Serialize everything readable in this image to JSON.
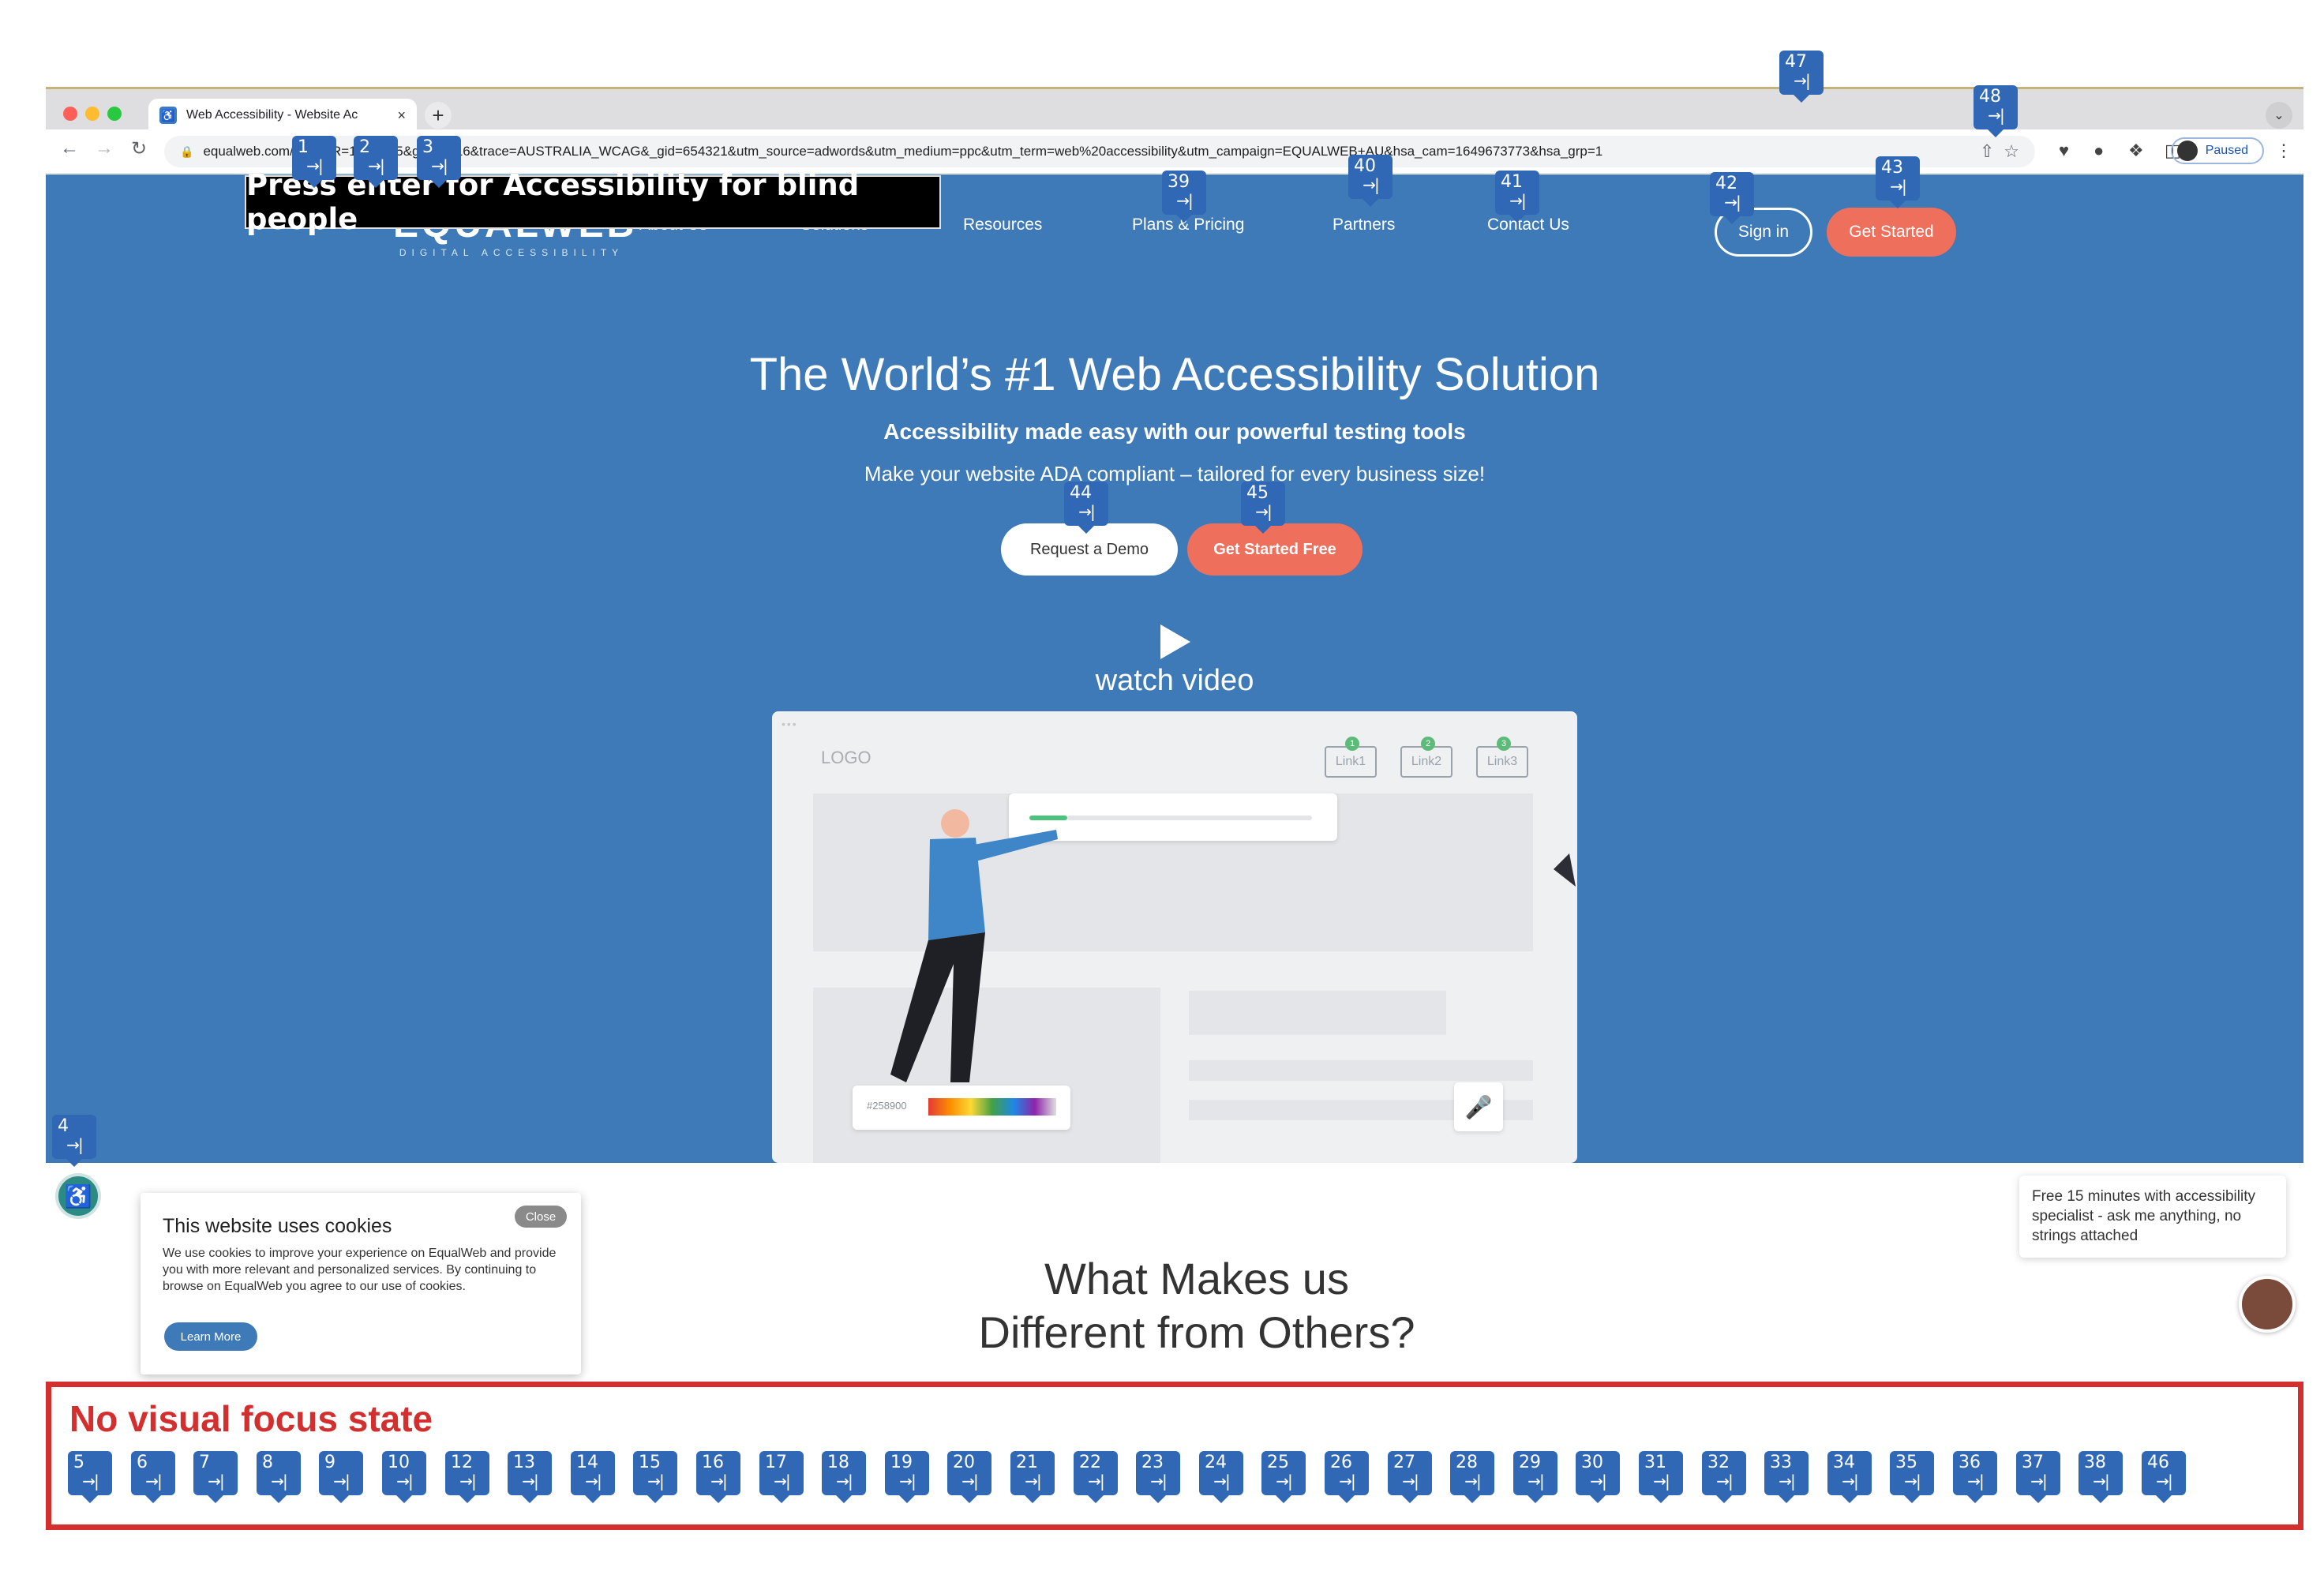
{
  "browser": {
    "tab_title": "Web Accessibility - Website Ac",
    "tab_close": "×",
    "new_tab": "+",
    "tab_search_icon": "chevron-down",
    "url": "equalweb.com/?initialR=1&bp=85&gad=1116&trace=AUSTRALIA_WCAG&_gid=654321&utm_source=adwords&utm_medium=ppc&utm_term=web%20accessibility&utm_campaign=EQUALWEB+AU&hsa_cam=1649673773&hsa_grp=1",
    "profile_label": "Paused",
    "traffic_colors": [
      "#ff5f57",
      "#febc2e",
      "#28c840"
    ]
  },
  "site": {
    "logo_text": "EQUALWEB",
    "logo_tagline": "DIGITAL ACCESSIBILITY",
    "nav": [
      "About Us",
      "Solutions",
      "Resources",
      "Plans & Pricing",
      "Partners",
      "Contact Us"
    ],
    "sign_in": "Sign in",
    "get_started": "Get Started",
    "hero_title": "The World’s #1 Web Accessibility Solution",
    "hero_subtitle": "Accessibility made easy with our powerful testing tools",
    "hero_desc": "Make your website ADA compliant – tailored for every business size!",
    "request_demo": "Request a Demo",
    "get_started_free": "Get Started Free",
    "watch_video": "watch video",
    "illustration": {
      "logo": "LOGO",
      "links": [
        {
          "n": "1",
          "label": "Link1"
        },
        {
          "n": "2",
          "label": "Link2"
        },
        {
          "n": "3",
          "label": "Link3"
        }
      ],
      "hex": "#258900",
      "dots": "•••"
    },
    "cookie": {
      "title": "This website uses cookies",
      "body": "We use cookies to improve your experience on EqualWeb and provide you with more relevant and personalized services. By continuing to browse on EqualWeb you agree to our use of cookies.",
      "close": "Close",
      "learn_more": "Learn More"
    },
    "section_title_line1": "What Makes us",
    "section_title_line2": "Different from Others?",
    "chat_text": "Free 15 minutes with accessibility specialist - ask me anything, no strings attached"
  },
  "annotations": {
    "blind_tooltip": "Press enter for Accessibility for blind people",
    "no_focus_title": "No visual focus state",
    "tab_arrow": "→|",
    "markers_top": [
      "1",
      "2",
      "3",
      "4",
      "39",
      "40",
      "41",
      "42",
      "43",
      "44",
      "45",
      "47",
      "48"
    ],
    "markers_bottom": [
      "5",
      "6",
      "7",
      "8",
      "9",
      "10",
      "12",
      "13",
      "14",
      "15",
      "16",
      "17",
      "18",
      "19",
      "20",
      "21",
      "22",
      "23",
      "24",
      "25",
      "26",
      "27",
      "28",
      "29",
      "30",
      "31",
      "32",
      "33",
      "34",
      "35",
      "36",
      "37",
      "38",
      "46"
    ]
  }
}
